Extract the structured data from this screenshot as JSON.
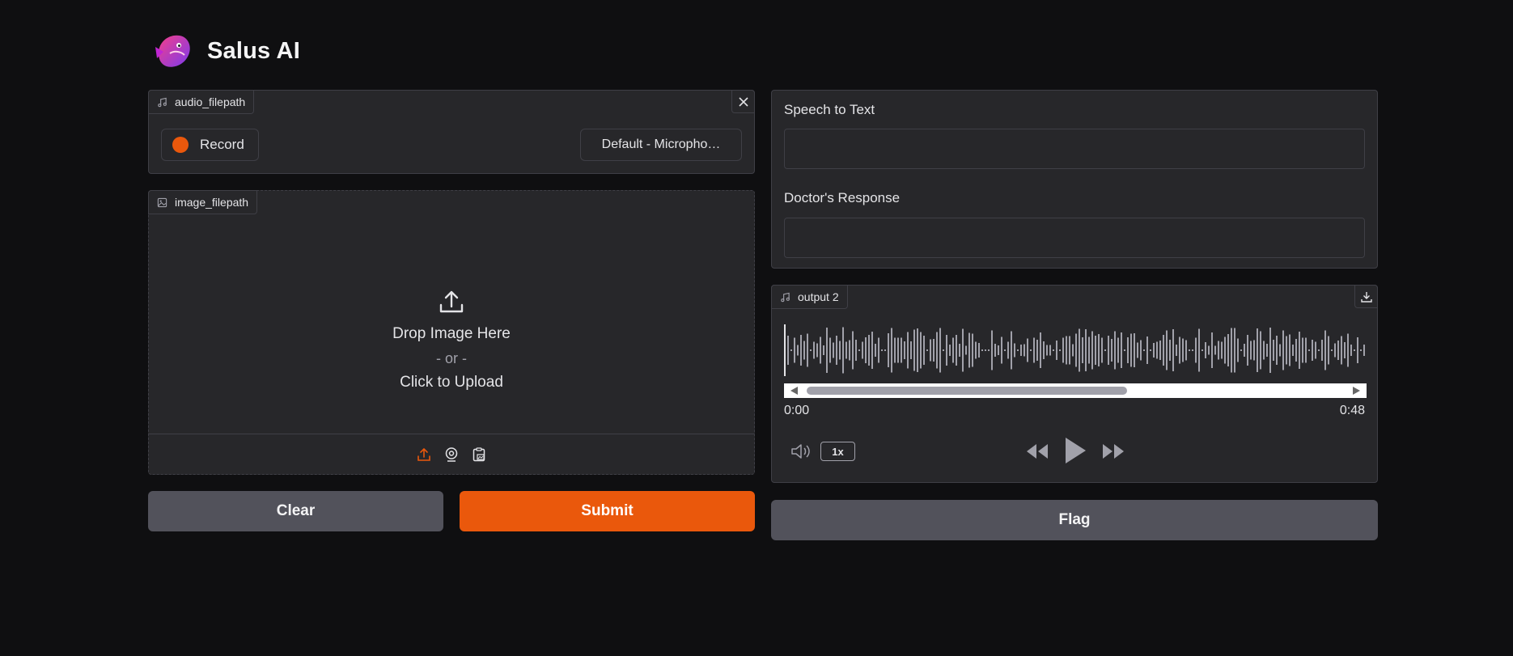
{
  "header": {
    "title": "Salus AI",
    "logo_icon": "fish-logo-icon"
  },
  "audio_input": {
    "label": "audio_filepath",
    "record_label": "Record",
    "device": "Default - Micropho…"
  },
  "image_input": {
    "label": "image_filepath",
    "drop_text": "Drop Image Here",
    "or_text": "- or -",
    "click_text": "Click to Upload"
  },
  "buttons": {
    "clear": "Clear",
    "submit": "Submit",
    "flag": "Flag"
  },
  "outputs": {
    "speech_label": "Speech to Text",
    "speech_value": "",
    "response_label": "Doctor's Response",
    "response_value": ""
  },
  "audio_output": {
    "label": "output 2",
    "time_current": "0:00",
    "time_total": "0:48",
    "speed": "1x"
  },
  "colors": {
    "accent": "#ea580c",
    "panel": "#27272a",
    "background": "#0f0f11",
    "border": "#3f3f46"
  }
}
